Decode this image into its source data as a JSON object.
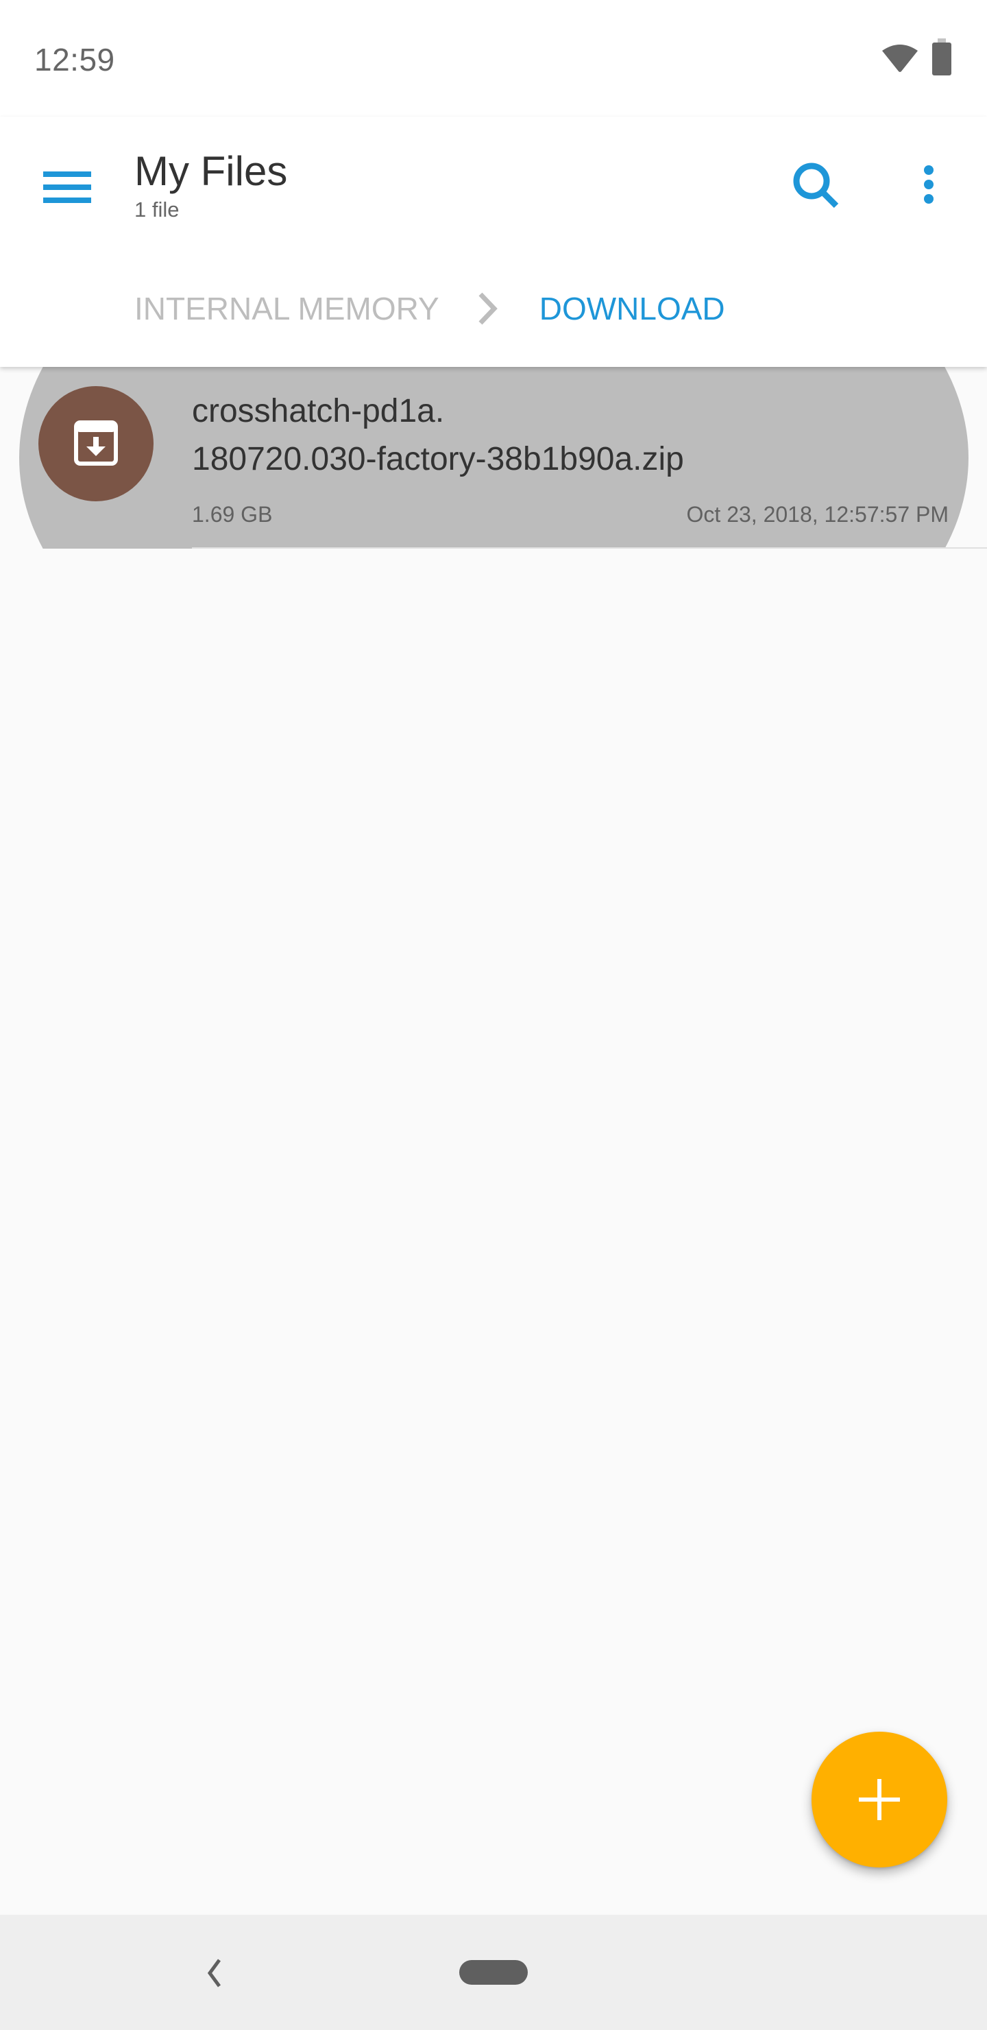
{
  "status_bar": {
    "time": "12:59",
    "icons": [
      "wifi-icon",
      "battery-icon"
    ]
  },
  "app_bar": {
    "title": "My Files",
    "subtitle": "1 file",
    "icons": {
      "menu": "hamburger-menu-icon",
      "search": "search-icon",
      "more": "more-vert-icon"
    }
  },
  "breadcrumb": {
    "items": [
      "INTERNAL MEMORY",
      "DOWNLOAD"
    ],
    "separator_icon": "chevron-right-icon"
  },
  "files": [
    {
      "name_line1": "crosshatch-pd1a.",
      "name_line2": "180720.030-factory-38b1b90a.zip",
      "size": "1.69 GB",
      "modified": "Oct 23, 2018, 12:57:57 PM",
      "icon": "archive-download-icon",
      "selected": true
    }
  ],
  "fab": {
    "icon": "plus-icon"
  },
  "nav_bar": {
    "icons": [
      "back-icon",
      "home-pill-icon"
    ]
  },
  "colors": {
    "accent": "#1e96d8",
    "fab": "#ffb000",
    "file_avatar": "#7b5546",
    "row_selected": "#bcbcbc"
  }
}
